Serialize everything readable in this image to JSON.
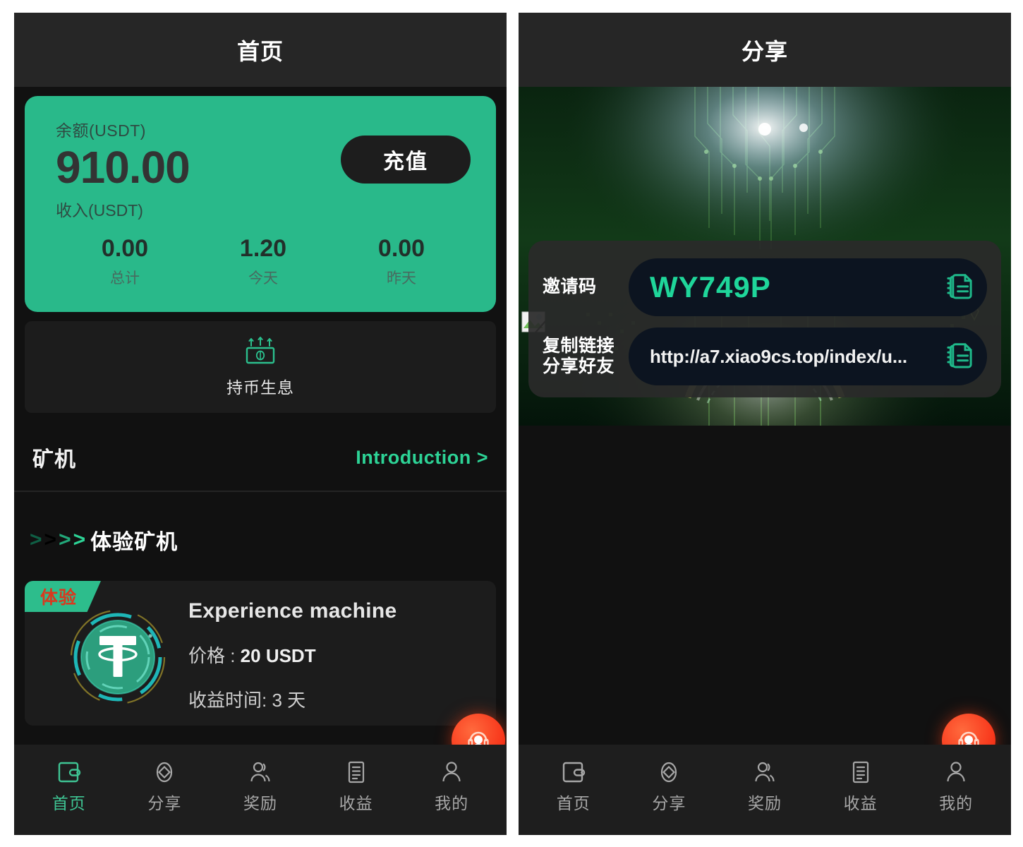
{
  "home": {
    "title": "首页",
    "balance": {
      "balance_label": "余额(USDT)",
      "balance_amount": "910.00",
      "topup_label": "充值",
      "income_label": "收入(USDT)",
      "stats": [
        {
          "value": "0.00",
          "caption": "总计"
        },
        {
          "value": "1.20",
          "caption": "今天"
        },
        {
          "value": "0.00",
          "caption": "昨天"
        }
      ]
    },
    "stake": {
      "label": "持币生息",
      "icon": "money-growth-icon"
    },
    "section": {
      "title": "矿机",
      "link": "Introduction >"
    },
    "group": {
      "title": "体验矿机",
      "chevrons": [
        ">",
        ">",
        ">",
        ">"
      ]
    },
    "machine": {
      "badge": "体验",
      "name": "Experience machine",
      "price_label": "价格 : ",
      "price_value": "20 USDT",
      "duration_label": "收益时间: ",
      "duration_value": "3 天",
      "coin_icon": "usdt-coin-icon"
    },
    "fab": {
      "icon": "customer-service-icon"
    }
  },
  "share": {
    "title": "分享",
    "invite_label": "邀请码",
    "invite_code": "WY749P",
    "link_label_line1": "复制链接",
    "link_label_line2": "分享好友",
    "link_value": "http://a7.xiao9cs.top/index/u...",
    "copy_icon": "copy-icon",
    "fab": {
      "icon": "customer-service-icon"
    }
  },
  "tabs": [
    {
      "label": "首页",
      "icon": "wallet-icon",
      "active": true
    },
    {
      "label": "分享",
      "icon": "diamond-icon",
      "active": false
    },
    {
      "label": "奖励",
      "icon": "people-icon",
      "active": false
    },
    {
      "label": "收益",
      "icon": "document-icon",
      "active": false
    },
    {
      "label": "我的",
      "icon": "person-icon",
      "active": false
    }
  ],
  "tabs_share": [
    {
      "label": "首页",
      "icon": "wallet-icon",
      "active": false
    },
    {
      "label": "分享",
      "icon": "diamond-icon",
      "active": false
    },
    {
      "label": "奖励",
      "icon": "people-icon",
      "active": false
    },
    {
      "label": "收益",
      "icon": "document-icon",
      "active": false
    },
    {
      "label": "我的",
      "icon": "person-icon",
      "active": false
    }
  ],
  "colors": {
    "brand_green": "#29b98a",
    "link_green": "#2dd396",
    "code_green": "#1fd69a",
    "panel_bg": "#111111",
    "titlebar_bg": "#262626",
    "tile_bg": "#1c1c1c",
    "fab_red": "#f8381c",
    "badge_text_red": "#d9381e"
  }
}
